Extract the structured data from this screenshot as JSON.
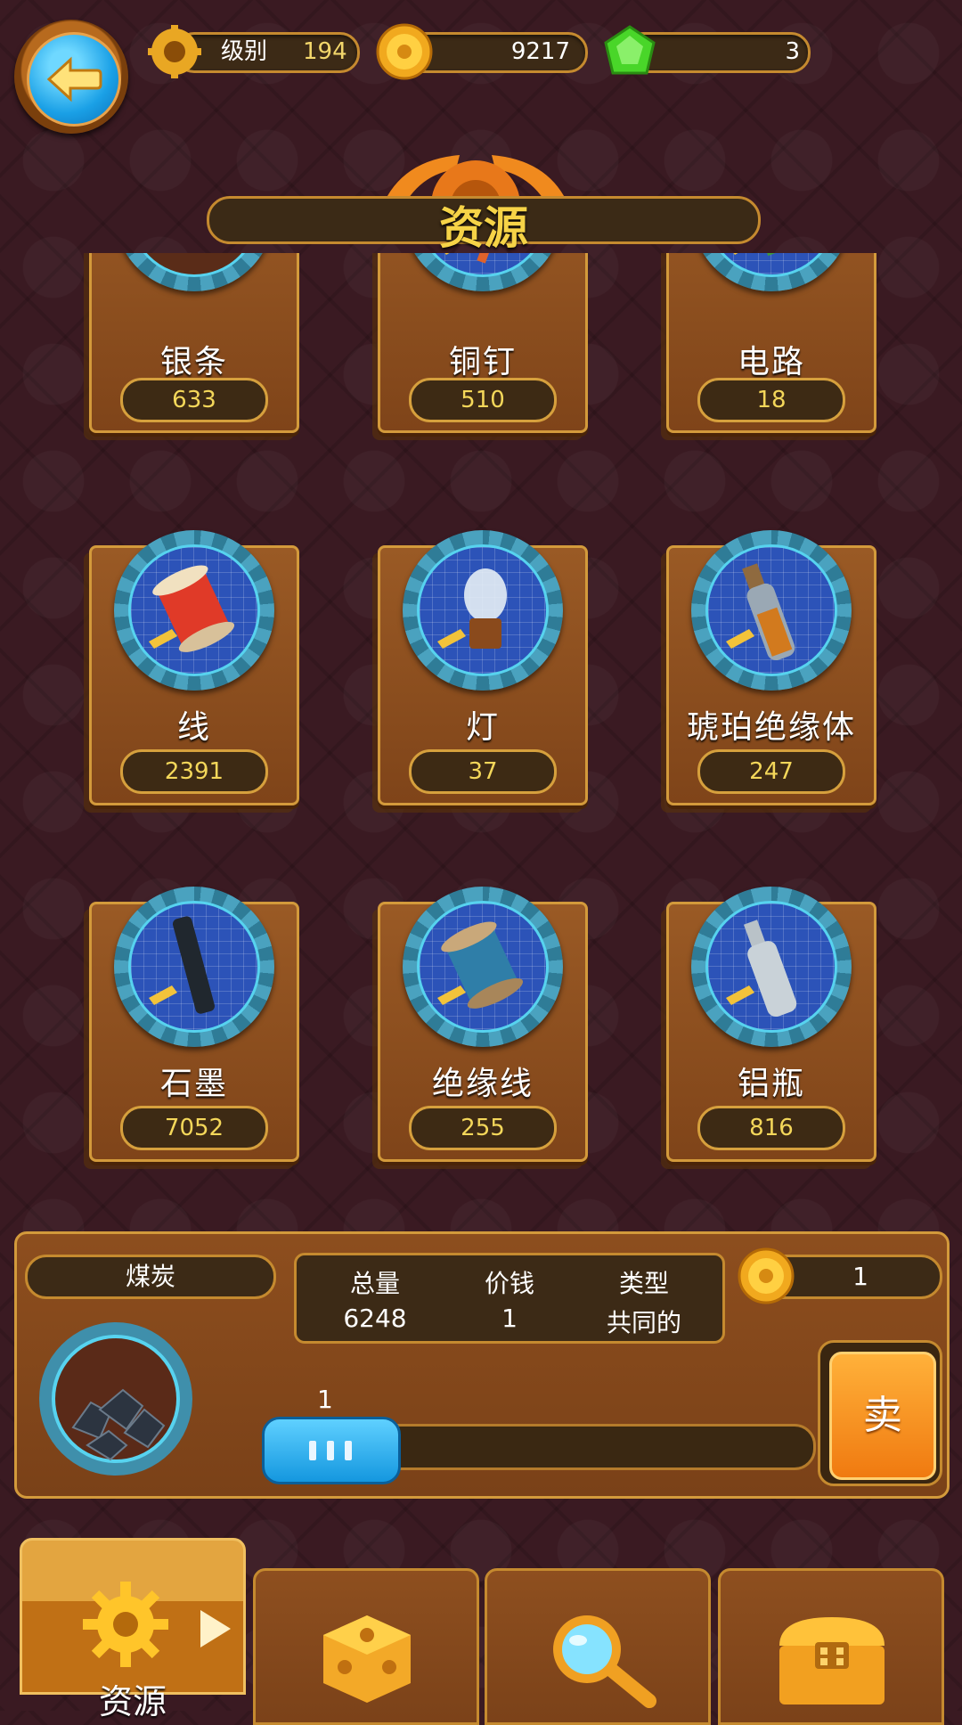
{
  "top_bar": {
    "level_label": "级别",
    "level_value": "194",
    "coins": "9217",
    "gems": "3"
  },
  "title": "资源",
  "resources": [
    {
      "name": "银条",
      "count": "633",
      "icon": "silver-bar-icon"
    },
    {
      "name": "铜钉",
      "count": "510",
      "icon": "copper-nail-icon"
    },
    {
      "name": "电路",
      "count": "18",
      "icon": "circuit-icon"
    },
    {
      "name": "线",
      "count": "2391",
      "icon": "thread-spool-icon"
    },
    {
      "name": "灯",
      "count": "37",
      "icon": "light-bulb-icon"
    },
    {
      "name": "琥珀绝缘体",
      "count": "247",
      "icon": "amber-bottle-icon"
    },
    {
      "name": "石墨",
      "count": "7052",
      "icon": "graphite-rod-icon"
    },
    {
      "name": "绝缘线",
      "count": "255",
      "icon": "insulated-wire-icon"
    },
    {
      "name": "铝瓶",
      "count": "816",
      "icon": "aluminum-bottle-icon"
    }
  ],
  "detail": {
    "name": "煤炭",
    "headers": [
      "总量",
      "价钱",
      "类型"
    ],
    "values": [
      "6248",
      "1",
      "共同的"
    ],
    "price_total": "1",
    "slider_value": "1",
    "sell_label": "卖"
  },
  "tabs": [
    {
      "label": "资源",
      "icon": "gear-icon",
      "active": true
    },
    {
      "label": "",
      "icon": "dice-icon",
      "active": false
    },
    {
      "label": "",
      "icon": "magnifier-icon",
      "active": false
    },
    {
      "label": "",
      "icon": "chest-icon",
      "active": false
    }
  ],
  "colors": {
    "background": "#3a1a22",
    "panel": "#8d4e1e",
    "accent_gold": "#f4d75a",
    "gem_green": "#49d629",
    "button_blue": "#1aa0e6"
  }
}
